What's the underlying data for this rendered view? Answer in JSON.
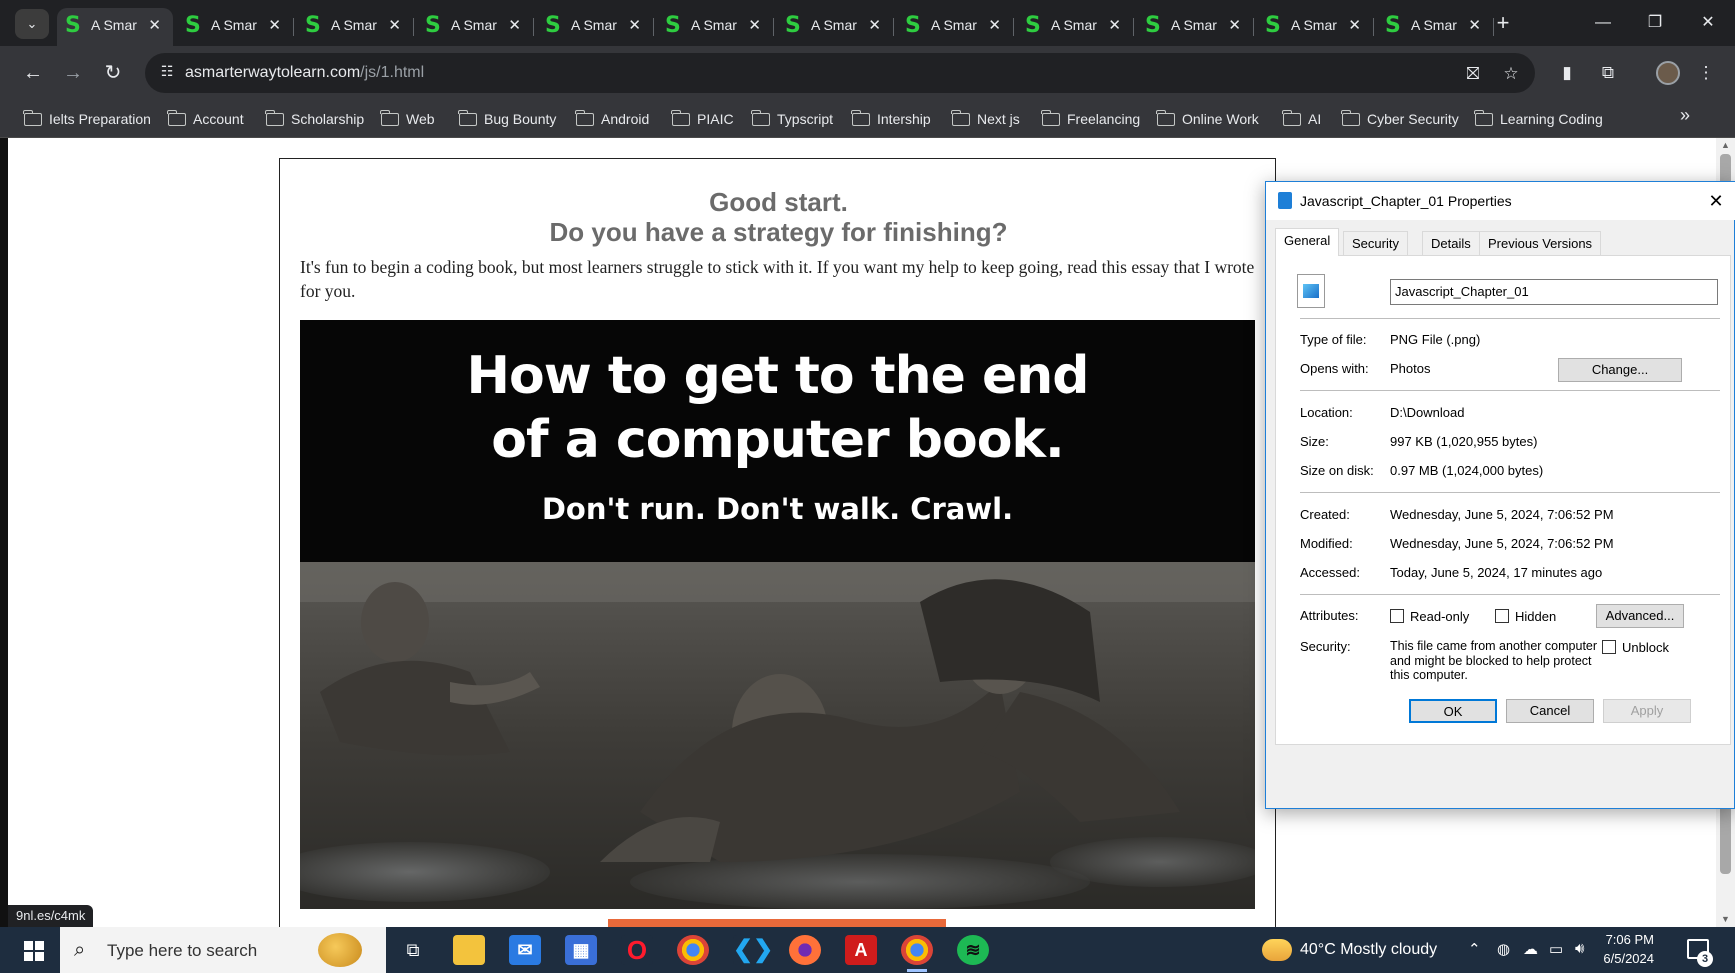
{
  "browser": {
    "tab_title": "A Smar",
    "tab_count": 12,
    "url_domain": "asmarterwaytolearn.com",
    "url_path": "/js/1.html",
    "bookmarks": [
      "Ielts Preparation",
      "Account",
      "Scholarship",
      "Web",
      "Bug Bounty",
      "Android",
      "PIAIC",
      "Typscript",
      "Intership",
      "Next js",
      "Freelancing",
      "Online Work",
      "AI",
      "Cyber Security",
      "Learning Coding"
    ],
    "status_url": "9nl.es/c4mk"
  },
  "article": {
    "heading_1": "Good start.",
    "heading_2": "Do you have a strategy for finishing?",
    "intro": "It's fun to begin a coding book, but most learners struggle to stick with it. If you want my help to keep going, read this essay that I wrote for you.",
    "hero_line_1": "How to get to the end",
    "hero_line_2": "of a computer book.",
    "hero_sub": "Don't run. Don't walk. Crawl."
  },
  "dialog": {
    "title": "Javascript_Chapter_01 Properties",
    "tabs": [
      "General",
      "Security",
      "Details",
      "Previous Versions"
    ],
    "filename": "Javascript_Chapter_01",
    "type_label": "Type of file:",
    "type_value": "PNG File (.png)",
    "opens_label": "Opens with:",
    "opens_value": "Photos",
    "change_button": "Change...",
    "location_label": "Location:",
    "location_value": "D:\\Download",
    "size_label": "Size:",
    "size_value": "997 KB (1,020,955 bytes)",
    "size_on_disk_label": "Size on disk:",
    "size_on_disk_value": "0.97 MB (1,024,000 bytes)",
    "created_label": "Created:",
    "created_value": "Wednesday, June 5, 2024, 7:06:52 PM",
    "modified_label": "Modified:",
    "modified_value": "Wednesday, June 5, 2024, 7:06:52 PM",
    "accessed_label": "Accessed:",
    "accessed_value": "Today, June 5, 2024, 17 minutes ago",
    "attributes_label": "Attributes:",
    "readonly_label": "Read-only",
    "hidden_label": "Hidden",
    "advanced_button": "Advanced...",
    "security_label": "Security:",
    "security_text": "This file came from another computer and might be blocked to help protect this computer.",
    "unblock_label": "Unblock",
    "ok_button": "OK",
    "cancel_button": "Cancel",
    "apply_button": "Apply"
  },
  "taskbar": {
    "search_placeholder": "Type here to search",
    "weather": "40°C  Mostly cloudy",
    "time": "7:06 PM",
    "date": "6/5/2024",
    "notification_count": "3"
  }
}
